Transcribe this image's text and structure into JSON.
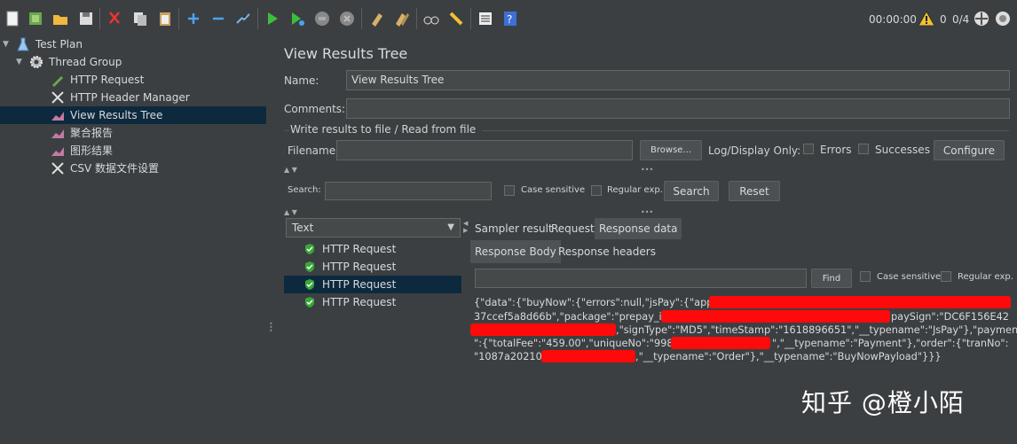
{
  "toolbar": {
    "icons": [
      "new-icon",
      "templates-icon",
      "open-icon",
      "save-icon",
      "cut-icon",
      "copy-icon",
      "paste-icon",
      "expand-icon",
      "collapse-icon",
      "toggle-icon",
      "start-icon",
      "start-no-pause-icon",
      "stop-icon",
      "shutdown-icon",
      "clear-icon",
      "clear-all-icon",
      "search-icon",
      "reset-search-icon",
      "function-helper-icon",
      "help-icon"
    ],
    "timer": "00:00:00",
    "active_threads": "0",
    "thread_ratio": "0/4"
  },
  "tree": {
    "items": [
      {
        "label": "Test Plan",
        "icon": "test-plan-icon"
      },
      {
        "label": "Thread Group",
        "icon": "gear-icon"
      },
      {
        "label": "HTTP Request",
        "icon": "pen-icon"
      },
      {
        "label": "HTTP Header Manager",
        "icon": "tools-icon"
      },
      {
        "label": "View Results Tree",
        "icon": "chart-icon"
      },
      {
        "label": "聚合报告",
        "icon": "chart-icon"
      },
      {
        "label": "图形结果",
        "icon": "chart-icon"
      },
      {
        "label": "CSV 数据文件设置",
        "icon": "tools-icon"
      }
    ]
  },
  "panel": {
    "title": "View Results Tree",
    "name_label": "Name:",
    "name_value": "View Results Tree",
    "comments_label": "Comments:",
    "comments_value": "",
    "write_results": "Write results to file / Read from file",
    "filename_label": "Filename",
    "filename_value": "",
    "browse": "Browse...",
    "log_display": "Log/Display Only:",
    "errors": "Errors",
    "successes": "Successes",
    "configure": "Configure",
    "search_label": "Search:",
    "case_sensitive": "Case sensitive",
    "regular_exp": "Regular exp.",
    "search_btn": "Search",
    "reset_btn": "Reset",
    "renderer": "Text",
    "results": [
      "HTTP Request",
      "HTTP Request",
      "HTTP Request",
      "HTTP Request"
    ],
    "tabs": [
      "Sampler result",
      "Request",
      "Response data"
    ],
    "subtabs": [
      "Response Body",
      "Response headers"
    ],
    "find": "Find",
    "response_lines": [
      "{\"data\":{\"buyNow\":{\"errors\":null,\"jsPay\":{\"appId\":",
      "37ccef5a8d66b\",\"package\":\"prepay_id=",
      "paySign\":\"DC6F156E42",
      ",\"signType\":\"MD5\",\"timeStamp\":\"1618896651\",\"__typename\":\"JsPay\"},\"payment",
      "\":{\"totalFee\":\"459.00\",\"uniqueNo\":\"998p2",
      "\",\"__typename\":\"Payment\"},\"order\":{\"tranNo\":",
      "\"1087a202104",
      ",\"__typename\":\"Order\"},\"__typename\":\"BuyNowPayload\"}}}"
    ]
  },
  "watermark": "知乎 @橙小陌"
}
